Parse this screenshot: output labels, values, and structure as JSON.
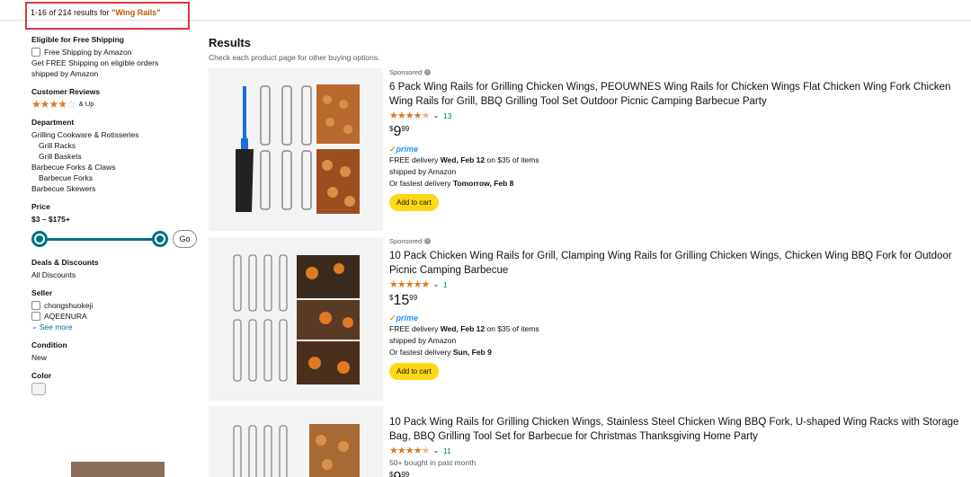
{
  "header": {
    "results_prefix": "1-16 of 214 results for ",
    "results_keyword": "\"Wing Rails\""
  },
  "sidebar": {
    "shipping": {
      "heading": "Eligible for Free Shipping",
      "option": "Free Shipping by Amazon",
      "note": "Get FREE Shipping on eligible orders shipped by Amazon"
    },
    "reviews": {
      "heading": "Customer Reviews",
      "stars": 4,
      "label": "& Up"
    },
    "department": {
      "heading": "Department",
      "items": [
        {
          "label": "Grilling Cookware & Rotisseries",
          "indent": false
        },
        {
          "label": "Grill Racks",
          "indent": true
        },
        {
          "label": "Grill Baskets",
          "indent": true
        },
        {
          "label": "Barbecue Forks & Claws",
          "indent": false
        },
        {
          "label": "Barbecue Forks",
          "indent": true
        },
        {
          "label": "Barbecue Skewers",
          "indent": false
        }
      ]
    },
    "price": {
      "heading": "Price",
      "range": "$3 – $175+",
      "go": "Go"
    },
    "deals": {
      "heading": "Deals & Discounts",
      "item": "All Discounts"
    },
    "seller": {
      "heading": "Seller",
      "items": [
        "chongshuokeji",
        "AQEENURA"
      ],
      "see_more": "See more"
    },
    "condition": {
      "heading": "Condition",
      "item": "New"
    },
    "color": {
      "heading": "Color"
    }
  },
  "main": {
    "title": "Results",
    "subtitle": "Check each product page for other buying options.",
    "products": [
      {
        "sponsored": "Sponsored",
        "title": "6 Pack Wing Rails for Grilling Chicken Wings, PEOUWNES Wing Rails for Chicken Wings Flat Chicken Wing Fork Chicken Wing Rails for Grill, BBQ Grilling Tool Set Outdoor Picnic Camping Barbecue Party",
        "rating": 4.5,
        "reviews": "13",
        "price_symbol": "$",
        "price_whole": "9",
        "price_cents": "99",
        "prime": "prime",
        "delivery_prefix": "FREE delivery ",
        "delivery_date": "Wed, Feb 12",
        "delivery_suffix": " on $35 of items",
        "shipped_by": "shipped by Amazon",
        "fastest_prefix": "Or fastest delivery ",
        "fastest_date": "Tomorrow, Feb 8",
        "button": "Add to cart"
      },
      {
        "sponsored": "Sponsored",
        "title": "10 Pack Chicken Wing Rails for Grill, Clamping Wing Rails for Grilling Chicken Wings, Chicken Wing BBQ Fork for Outdoor Picnic Camping Barbecue",
        "rating": 5,
        "reviews": "1",
        "price_symbol": "$",
        "price_whole": "15",
        "price_cents": "99",
        "prime": "prime",
        "delivery_prefix": "FREE delivery ",
        "delivery_date": "Wed, Feb 12",
        "delivery_suffix": " on $35 of items",
        "shipped_by": "shipped by Amazon",
        "fastest_prefix": "Or fastest delivery ",
        "fastest_date": "Sun, Feb 9",
        "button": "Add to cart"
      },
      {
        "title": "10 Pack Wing Rails for Grilling Chicken Wings, Stainless Steel Chicken Wing BBQ Fork, U-shaped Wing Racks with Storage Bag, BBQ Grilling Tool Set for Barbecue for Christmas Thanksgiving Home Party",
        "rating": 4.5,
        "reviews": "11",
        "bought": "50+ bought in past month",
        "price_symbol": "$",
        "price_whole": "9",
        "price_cents": "99"
      }
    ]
  },
  "colors": {
    "link": "#007185",
    "star": "#de7921",
    "cart_button": "#ffd814",
    "highlight_border": "#d63a3a",
    "keyword": "#c45500"
  }
}
